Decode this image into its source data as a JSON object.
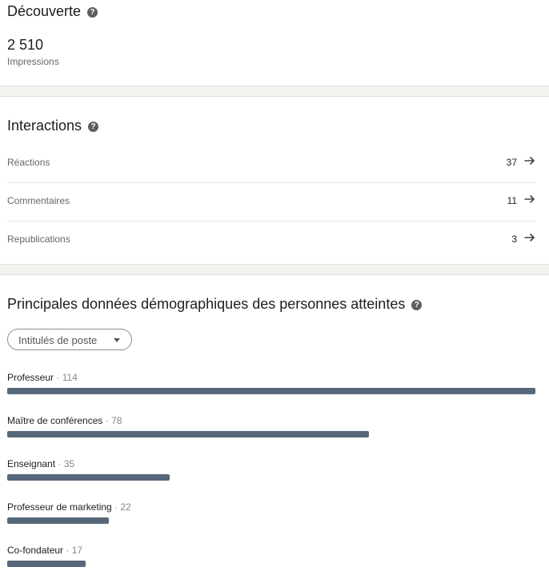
{
  "discovery": {
    "title": "Découverte",
    "impressions_value": "2 510",
    "impressions_label": "Impressions"
  },
  "interactions": {
    "title": "Interactions",
    "rows": [
      {
        "label": "Réactions",
        "value": "37"
      },
      {
        "label": "Commentaires",
        "value": "11"
      },
      {
        "label": "Republications",
        "value": "3"
      }
    ]
  },
  "demographics": {
    "title": "Principales données démographiques des personnes atteintes",
    "filter_label": "Intitulés de poste",
    "separator": "·",
    "items": [
      {
        "name": "Professeur",
        "count": 114
      },
      {
        "name": "Maître de conférences",
        "count": 78
      },
      {
        "name": "Enseignant",
        "count": 35
      },
      {
        "name": "Professeur de marketing",
        "count": 22
      },
      {
        "name": "Co-fondateur",
        "count": 17
      }
    ]
  },
  "icons": {
    "help": "question-circle-icon",
    "row_arrow": "arrow-right-icon",
    "dropdown_caret": "caret-down-icon"
  },
  "colors": {
    "bar": "#56687a",
    "band": "#f3f2ef",
    "muted_text": "#666666"
  }
}
